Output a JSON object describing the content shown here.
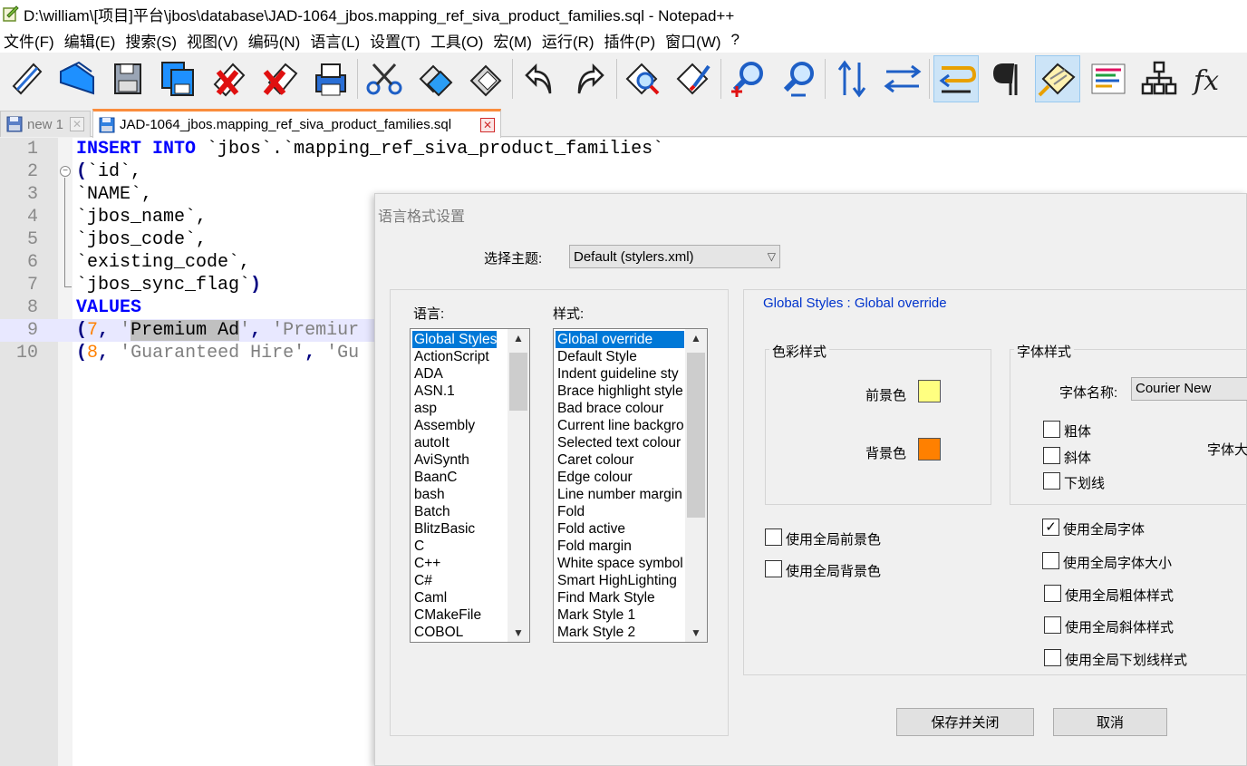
{
  "window": {
    "title": "D:\\william\\[项目]平台\\jbos\\database\\JAD-1064_jbos.mapping_ref_siva_product_families.sql - Notepad++"
  },
  "menu": [
    "文件(F)",
    "编辑(E)",
    "搜索(S)",
    "视图(V)",
    "编码(N)",
    "语言(L)",
    "设置(T)",
    "工具(O)",
    "宏(M)",
    "运行(R)",
    "插件(P)",
    "窗口(W)",
    "?"
  ],
  "toolbar": {
    "buttons": [
      {
        "icon": "new-file-icon"
      },
      {
        "icon": "open-file-icon"
      },
      {
        "icon": "save-icon"
      },
      {
        "icon": "save-all-icon"
      },
      {
        "icon": "close-icon"
      },
      {
        "icon": "close-all-icon"
      },
      {
        "icon": "print-icon"
      },
      {
        "icon": "cut-icon"
      },
      {
        "icon": "copy-icon"
      },
      {
        "icon": "paste-icon"
      },
      {
        "icon": "undo-icon"
      },
      {
        "icon": "redo-icon"
      },
      {
        "icon": "find-icon"
      },
      {
        "icon": "replace-icon"
      },
      {
        "icon": "zoom-in-icon"
      },
      {
        "icon": "zoom-out-icon"
      },
      {
        "icon": "sync-vertical-icon"
      },
      {
        "icon": "sync-horizontal-icon"
      },
      {
        "icon": "word-wrap-icon"
      },
      {
        "icon": "show-all-chars-icon"
      },
      {
        "icon": "indent-guide-icon"
      },
      {
        "icon": "udl-icon"
      },
      {
        "icon": "doc-map-icon"
      },
      {
        "icon": "function-list-icon"
      }
    ]
  },
  "tabs": [
    {
      "label": "new 1",
      "close": "✕"
    },
    {
      "label": "JAD-1064_jbos.mapping_ref_siva_product_families.sql",
      "close": "✕"
    }
  ],
  "editor": {
    "lines": [
      {
        "n": "1",
        "tokens": [
          [
            "kw",
            "INSERT"
          ],
          [
            "plain",
            " "
          ],
          [
            "kw",
            "INTO"
          ],
          [
            "plain",
            " `jbos`.`mapping_ref_siva_product_families`"
          ]
        ]
      },
      {
        "n": "2",
        "tokens": [
          [
            "op",
            "("
          ],
          [
            "plain",
            "`id`,"
          ]
        ]
      },
      {
        "n": "3",
        "tokens": [
          [
            "plain",
            "`NAME`,"
          ]
        ]
      },
      {
        "n": "4",
        "tokens": [
          [
            "plain",
            "`jbos_name`,"
          ]
        ]
      },
      {
        "n": "5",
        "tokens": [
          [
            "plain",
            "`jbos_code`,"
          ]
        ]
      },
      {
        "n": "6",
        "tokens": [
          [
            "plain",
            "`existing_code`,"
          ]
        ]
      },
      {
        "n": "7",
        "tokens": [
          [
            "plain",
            "`jbos_sync_flag`"
          ],
          [
            "op",
            ")"
          ]
        ]
      },
      {
        "n": "8",
        "tokens": [
          [
            "kw",
            "VALUES"
          ]
        ]
      },
      {
        "n": "9",
        "tokens": [
          [
            "op",
            "("
          ],
          [
            "num",
            "7"
          ],
          [
            "op",
            ","
          ],
          [
            "plain",
            " "
          ],
          [
            "str",
            "'"
          ],
          [
            "sel",
            "Premium Ad"
          ],
          [
            "str",
            "'"
          ],
          [
            "op",
            ","
          ],
          [
            "plain",
            " "
          ],
          [
            "str",
            "'Premiur"
          ]
        ]
      },
      {
        "n": "10",
        "tokens": [
          [
            "op",
            "("
          ],
          [
            "num",
            "8"
          ],
          [
            "op",
            ","
          ],
          [
            "plain",
            " "
          ],
          [
            "str",
            "'Guaranteed Hire'"
          ],
          [
            "op",
            ","
          ],
          [
            "plain",
            " "
          ],
          [
            "str",
            "'Gu"
          ]
        ]
      }
    ]
  },
  "dialog": {
    "title": "语言格式设置",
    "theme_label": "选择主题:",
    "theme_value": "Default (stylers.xml)",
    "language_label": "语言:",
    "style_label": "样式:",
    "languages": [
      "Global Styles",
      "ActionScript",
      "ADA",
      "ASN.1",
      "asp",
      "Assembly",
      "autoIt",
      "AviSynth",
      "BaanC",
      "bash",
      "Batch",
      "BlitzBasic",
      "C",
      "C++",
      "C#",
      "Caml",
      "CMakeFile",
      "COBOL"
    ],
    "styles": [
      "Global override",
      "Default Style",
      "Indent guideline sty",
      "Brace highlight style",
      "Bad brace colour",
      "Current line backgro",
      "Selected text colour",
      "Caret colour",
      "Edge colour",
      "Line number margin",
      "Fold",
      "Fold active",
      "Fold margin",
      "White space symbol",
      "Smart HighLighting",
      "Find Mark Style",
      "Mark Style 1",
      "Mark Style 2"
    ],
    "style_header": "Global Styles : Global override",
    "color_group": "色彩样式",
    "fg_label": "前景色",
    "bg_label": "背景色",
    "fg_color": "#ffff80",
    "bg_color": "#ff8000",
    "font_group": "字体样式",
    "font_name_label": "字体名称:",
    "font_name_value": "Courier New",
    "font_size_label": "字体大",
    "bold": "粗体",
    "italic": "斜体",
    "underline": "下划线",
    "use_global_fg": "使用全局前景色",
    "use_global_bg": "使用全局背景色",
    "use_global_font": "使用全局字体",
    "use_global_font_size": "使用全局字体大小",
    "use_global_bold": "使用全局粗体样式",
    "use_global_italic": "使用全局斜体样式",
    "use_global_underline": "使用全局下划线样式",
    "check_mark": "✓",
    "save_close": "保存并关闭",
    "cancel": "取消",
    "scroll_up": "▲",
    "scroll_down": "▼",
    "chevron": "▽"
  }
}
